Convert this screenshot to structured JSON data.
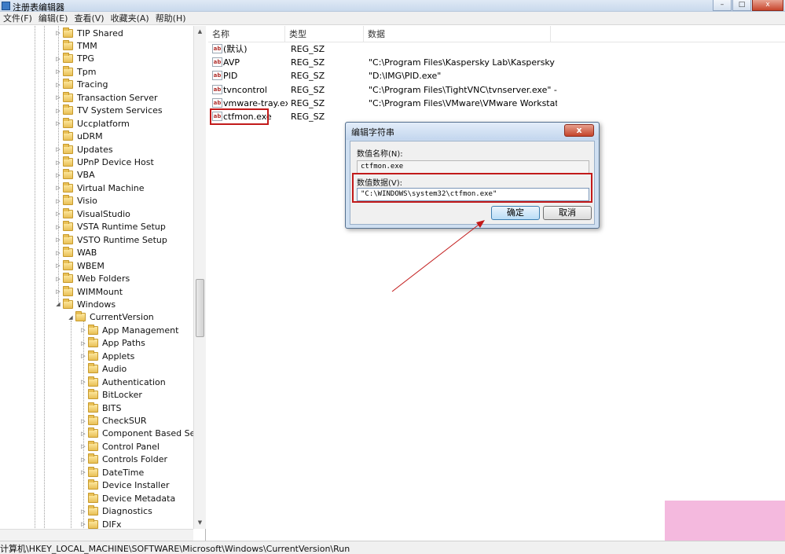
{
  "window": {
    "title": "注册表编辑器",
    "minimize_glyph": "–",
    "maximize_glyph": "□",
    "close_glyph": "x"
  },
  "menu": [
    "文件(F)",
    "编辑(E)",
    "查看(V)",
    "收藏夹(A)",
    "帮助(H)"
  ],
  "tree": {
    "collapsed_arrow": "▷",
    "expanded_arrow": "◢",
    "items": [
      {
        "label": "TIP Shared",
        "state": "collapsed",
        "level": 0
      },
      {
        "label": "TMM",
        "state": "leaf",
        "level": 0
      },
      {
        "label": "TPG",
        "state": "collapsed",
        "level": 0
      },
      {
        "label": "Tpm",
        "state": "collapsed",
        "level": 0
      },
      {
        "label": "Tracing",
        "state": "collapsed",
        "level": 0
      },
      {
        "label": "Transaction Server",
        "state": "collapsed",
        "level": 0
      },
      {
        "label": "TV System Services",
        "state": "collapsed",
        "level": 0
      },
      {
        "label": "Uccplatform",
        "state": "collapsed",
        "level": 0
      },
      {
        "label": "uDRM",
        "state": "leaf",
        "level": 0
      },
      {
        "label": "Updates",
        "state": "collapsed",
        "level": 0
      },
      {
        "label": "UPnP Device Host",
        "state": "collapsed",
        "level": 0
      },
      {
        "label": "VBA",
        "state": "collapsed",
        "level": 0
      },
      {
        "label": "Virtual Machine",
        "state": "collapsed",
        "level": 0
      },
      {
        "label": "Visio",
        "state": "collapsed",
        "level": 0
      },
      {
        "label": "VisualStudio",
        "state": "collapsed",
        "level": 0
      },
      {
        "label": "VSTA Runtime Setup",
        "state": "collapsed",
        "level": 0
      },
      {
        "label": "VSTO Runtime Setup",
        "state": "collapsed",
        "level": 0
      },
      {
        "label": "WAB",
        "state": "collapsed",
        "level": 0
      },
      {
        "label": "WBEM",
        "state": "collapsed",
        "level": 0
      },
      {
        "label": "Web Folders",
        "state": "collapsed",
        "level": 0
      },
      {
        "label": "WIMMount",
        "state": "collapsed",
        "level": 0
      },
      {
        "label": "Windows",
        "state": "expanded",
        "level": 0
      },
      {
        "label": "CurrentVersion",
        "state": "expanded",
        "level": 1
      },
      {
        "label": "App Management",
        "state": "collapsed",
        "level": 2
      },
      {
        "label": "App Paths",
        "state": "collapsed",
        "level": 2
      },
      {
        "label": "Applets",
        "state": "collapsed",
        "level": 2
      },
      {
        "label": "Audio",
        "state": "leaf",
        "level": 2
      },
      {
        "label": "Authentication",
        "state": "collapsed",
        "level": 2
      },
      {
        "label": "BitLocker",
        "state": "leaf",
        "level": 2
      },
      {
        "label": "BITS",
        "state": "leaf",
        "level": 2
      },
      {
        "label": "CheckSUR",
        "state": "collapsed",
        "level": 2
      },
      {
        "label": "Component Based Servi",
        "state": "collapsed",
        "level": 2
      },
      {
        "label": "Control Panel",
        "state": "collapsed",
        "level": 2
      },
      {
        "label": "Controls Folder",
        "state": "collapsed",
        "level": 2
      },
      {
        "label": "DateTime",
        "state": "collapsed",
        "level": 2
      },
      {
        "label": "Device Installer",
        "state": "leaf",
        "level": 2
      },
      {
        "label": "Device Metadata",
        "state": "leaf",
        "level": 2
      },
      {
        "label": "Diagnostics",
        "state": "collapsed",
        "level": 2
      },
      {
        "label": "DIFx",
        "state": "collapsed",
        "level": 2
      }
    ]
  },
  "list": {
    "columns": [
      "名称",
      "类型",
      "数据"
    ],
    "rows": [
      {
        "name": "(默认)",
        "type": "REG_SZ",
        "data": ""
      },
      {
        "name": "AVP",
        "type": "REG_SZ",
        "data": "\"C:\\Program Files\\Kaspersky Lab\\Kaspersky ..."
      },
      {
        "name": "PID",
        "type": "REG_SZ",
        "data": "\"D:\\IMG\\PID.exe\""
      },
      {
        "name": "tvncontrol",
        "type": "REG_SZ",
        "data": "\"C:\\Program Files\\TightVNC\\tvnserver.exe\" -c..."
      },
      {
        "name": "vmware-tray.exe",
        "type": "REG_SZ",
        "data": "\"C:\\Program Files\\VMware\\VMware Workstati..."
      },
      {
        "name": "ctfmon.exe",
        "type": "REG_SZ",
        "data": ""
      }
    ],
    "icon_text": "ab"
  },
  "dialog": {
    "title": "编辑字符串",
    "close_glyph": "x",
    "name_label": "数值名称(N):",
    "name_value": "ctfmon.exe",
    "data_label": "数值数据(V):",
    "data_value": "\"C:\\WINDOWS\\system32\\ctfmon.exe\"",
    "ok_label": "确定",
    "cancel_label": "取消"
  },
  "scrollbar": {
    "up": "▲",
    "down": "▼"
  },
  "statusbar": {
    "path": "计算机\\HKEY_LOCAL_MACHINE\\SOFTWARE\\Microsoft\\Windows\\CurrentVersion\\Run"
  },
  "colors": {
    "highlight": "#c21a1a",
    "arrow": "#c21a1a",
    "watermark_block": "#f4b9de"
  }
}
